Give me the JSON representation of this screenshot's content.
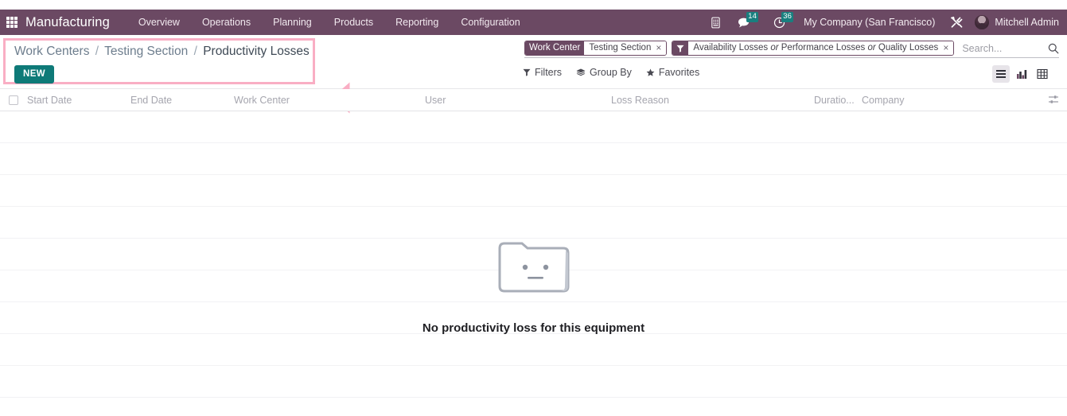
{
  "navbar": {
    "apps_icon": "apps-grid-icon",
    "brand": "Manufacturing",
    "menu": [
      {
        "label": "Overview"
      },
      {
        "label": "Operations"
      },
      {
        "label": "Planning"
      },
      {
        "label": "Products"
      },
      {
        "label": "Reporting"
      },
      {
        "label": "Configuration"
      }
    ],
    "icons": {
      "phone": "phone-icon",
      "messages": "messages-icon",
      "activities": "activities-clock-icon",
      "tools": "tools-icon"
    },
    "messages_count": "14",
    "activities_count": "36",
    "company": "My Company (San Francisco)",
    "user": "Mitchell Admin",
    "badge_color": "#197f7f",
    "background_color": "#6b4963"
  },
  "control_panel": {
    "breadcrumb": {
      "root": "Work Centers",
      "sep1": "/",
      "parent": "Testing Section",
      "sep2": "/",
      "current": "Productivity Losses"
    },
    "new_button": "NEW",
    "new_button_color": "#0e7a78",
    "highlight_color": "#f9aec4",
    "annotation_arrow": "left-arrow-annotation"
  },
  "search": {
    "facets": [
      {
        "label": "Work Center",
        "value": "Testing Section",
        "remove": "×"
      },
      {
        "icon": "filter-funnel-icon",
        "part1": "Availability Losses",
        "or1": "or",
        "part2": "Performance Losses",
        "or2": "or",
        "part3": "Quality Losses",
        "remove": "×"
      }
    ],
    "placeholder": "Search...",
    "search_icon": "search-magnifier-icon"
  },
  "filter_row": {
    "filters": "Filters",
    "group_by": "Group By",
    "favorites": "Favorites",
    "views": [
      {
        "name": "list-view",
        "active": true
      },
      {
        "name": "graph-view",
        "active": false
      },
      {
        "name": "pivot-view",
        "active": false
      }
    ]
  },
  "list": {
    "columns": [
      "Start Date",
      "End Date",
      "Work Center",
      "User",
      "Loss Reason",
      "Duratio...",
      "Company"
    ],
    "rows": [],
    "optional_columns_icon": "sliders-icon"
  },
  "empty_state": {
    "illustration": "empty-folder-face-icon",
    "message": "No productivity loss for this equipment"
  }
}
